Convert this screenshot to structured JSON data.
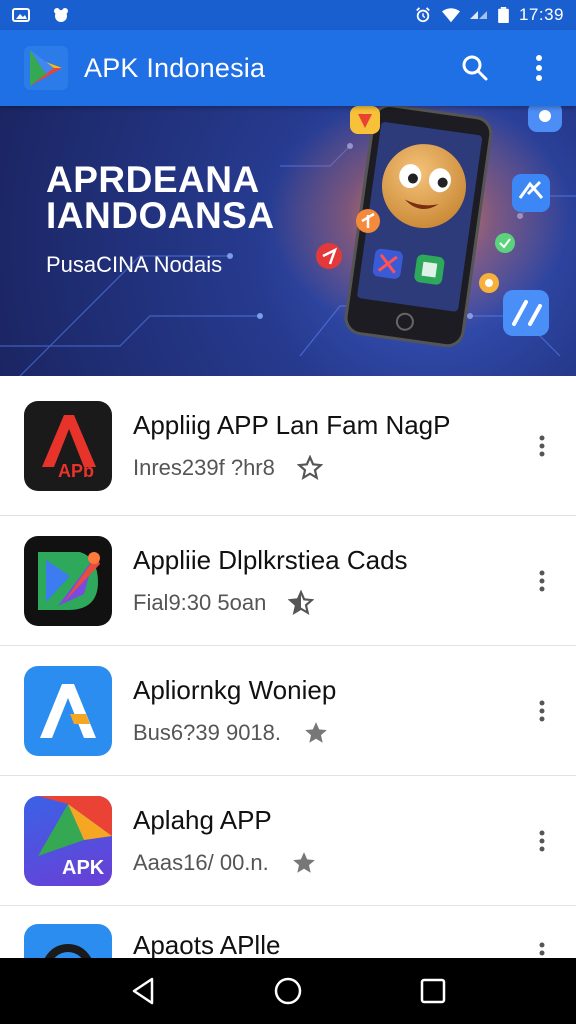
{
  "status_bar": {
    "time": "17:39",
    "icons": [
      "gallery-icon",
      "notification-icon",
      "alarm-icon",
      "wifi-icon",
      "signal-icon",
      "battery-icon"
    ]
  },
  "app_bar": {
    "title": "APK Indonesia",
    "icons": [
      "play-store-logo",
      "search-icon",
      "more-vert-icon"
    ]
  },
  "banner": {
    "line1": "APRDEANA",
    "line2": "IANDOANSA",
    "subtitle": "PusaCINA Nodais"
  },
  "apps": [
    {
      "title": "Appliig APP Lan Fam NagP",
      "subtitle": "Inres239f ?hr8",
      "icon_label": "APb",
      "icon": "adobe-style-app-icon"
    },
    {
      "title": "Appliie Dlplkrstiea Cads",
      "subtitle": "Fial9:30 5oan",
      "icon_label": "",
      "icon": "bird-app-icon"
    },
    {
      "title": "Apliornkg Woniep",
      "subtitle": "Bus6?39 9018.",
      "icon_label": "",
      "icon": "letter-a-app-icon"
    },
    {
      "title": "Aplahg APP",
      "subtitle": "Aaas16/ 00.n.",
      "icon_label": "APK",
      "icon": "apk-app-icon"
    },
    {
      "title": "Apaots APlle",
      "subtitle": "",
      "icon_label": "",
      "icon": "circle-app-icon"
    }
  ],
  "nav_bar": {
    "buttons": [
      "back-icon",
      "home-icon",
      "recents-icon"
    ]
  },
  "colors": {
    "status_bar": "#1a5fd0",
    "app_bar": "#1f6fe5",
    "banner_bg": "#263a8e",
    "nav_bar": "#000000"
  }
}
